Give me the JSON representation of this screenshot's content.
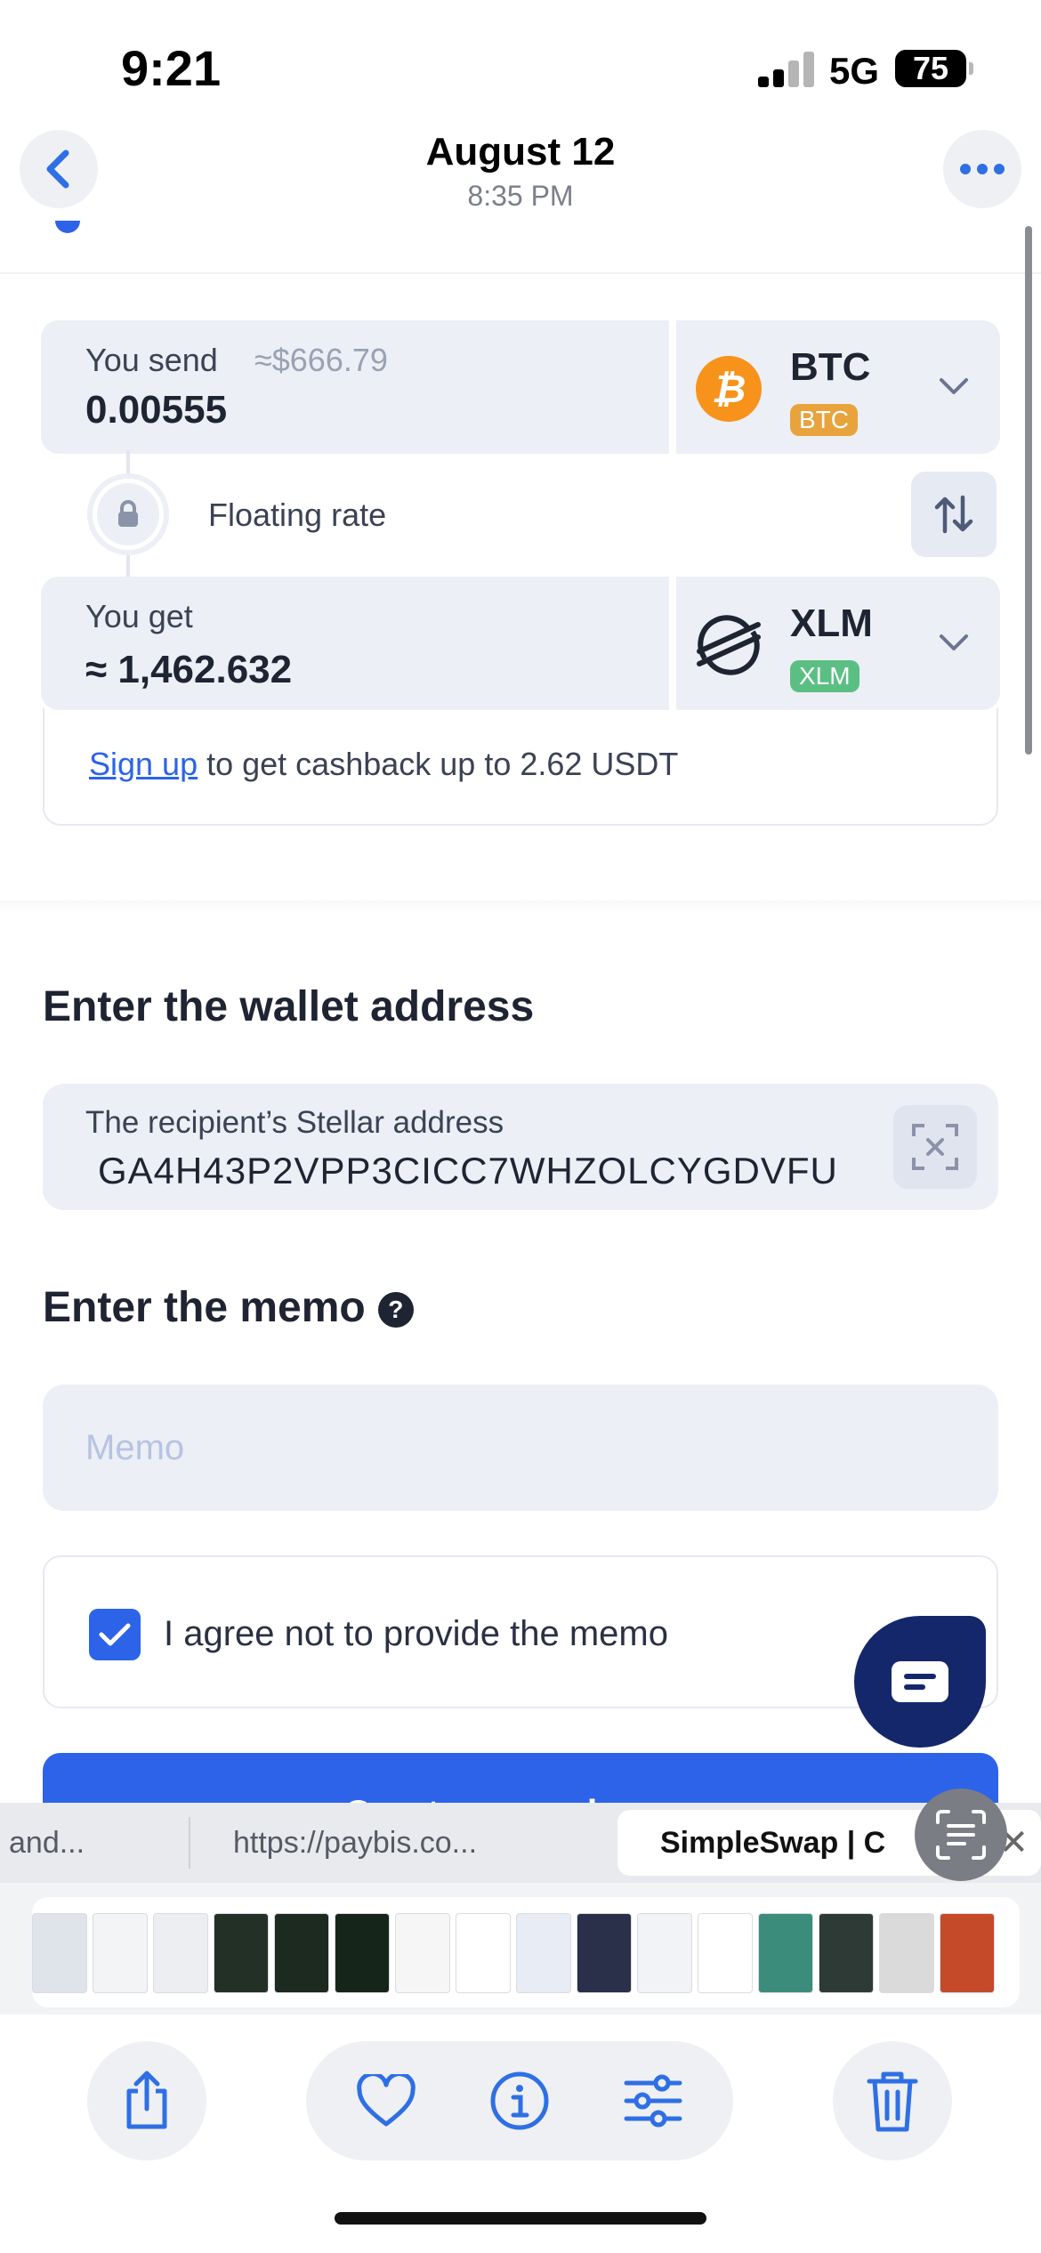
{
  "status_bar": {
    "time": "9:21",
    "network": "5G",
    "battery": "75"
  },
  "header": {
    "title": "August 12",
    "subtitle": "8:35 PM"
  },
  "exchange": {
    "send": {
      "label": "You send",
      "approx": "≈$666.79",
      "value": "0.00555",
      "coin": "BTC",
      "badge": "BTC",
      "color": "#f7931a",
      "badge_color": "#e8a33c"
    },
    "rate_label": "Floating rate",
    "get": {
      "label": "You get",
      "value": "≈ 1,462.632",
      "coin": "XLM",
      "badge": "XLM",
      "badge_color": "#5bbf83"
    },
    "cashback": {
      "link": "Sign up",
      "text": " to get cashback up to 2.62 USDT"
    }
  },
  "wallet": {
    "title": "Enter the wallet address",
    "label": "The recipient’s Stellar address",
    "value": "GA4H43P2VPP3CICC7WHZOLCYGDVFU"
  },
  "memo": {
    "title": "Enter the memo",
    "help": "?",
    "placeholder": "Memo"
  },
  "agree": {
    "label": "I agree not to provide the memo",
    "checked": true
  },
  "create_button": {
    "label": "Create an exchange"
  },
  "browser_tabs": [
    {
      "label": "and..."
    },
    {
      "label": "https://paybis.co..."
    },
    {
      "label": "SimpleSwap | C"
    }
  ],
  "thumb_colors": [
    "#dfe3ea",
    "#f3f4f6",
    "#eceef2",
    "#233026",
    "#1c2a1f",
    "#162519",
    "#f6f6f6",
    "#ffffff",
    "#e8ecf4",
    "#2a2f4a",
    "#f2f3f7",
    "#ffffff",
    "#3c8c7c",
    "#2d3a36",
    "#dadada",
    "#c44a2a"
  ],
  "colors": {
    "accent": "#2c63e8",
    "chat": "#15276b"
  }
}
